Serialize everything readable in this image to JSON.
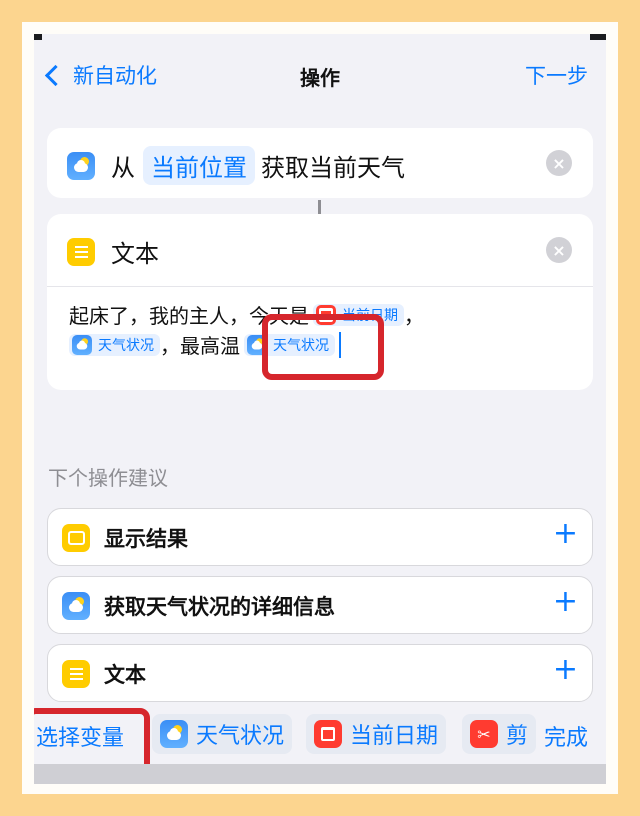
{
  "nav": {
    "back_label": "新自动化",
    "title": "操作",
    "next_label": "下一步"
  },
  "weather_action": {
    "from_label": "从",
    "location_token": "当前位置",
    "action_label": "获取当前天气"
  },
  "text_action": {
    "title": "文本",
    "line1_prefix": "起床了，我的主人，今天是",
    "date_token": "当前日期",
    "line1_suffix": "，",
    "weather_token_1": "天气状况",
    "line2_middle": "，最高温",
    "weather_token_2": "天气状况"
  },
  "suggestions": {
    "section_title": "下个操作建议",
    "items": [
      {
        "label": "显示结果",
        "icon": "result-icon"
      },
      {
        "label": "获取天气状况的详细信息",
        "icon": "weather-icon"
      },
      {
        "label": "文本",
        "icon": "text-icon"
      }
    ]
  },
  "bottom_bar": {
    "choose_variable": "选择变量",
    "weather_variable": "天气状况",
    "date_variable": "当前日期",
    "clipboard_variable": "剪",
    "done_label": "完成"
  },
  "colors": {
    "accent": "#0a7aff",
    "highlight": "#d6262c",
    "background": "#fcd58f"
  }
}
